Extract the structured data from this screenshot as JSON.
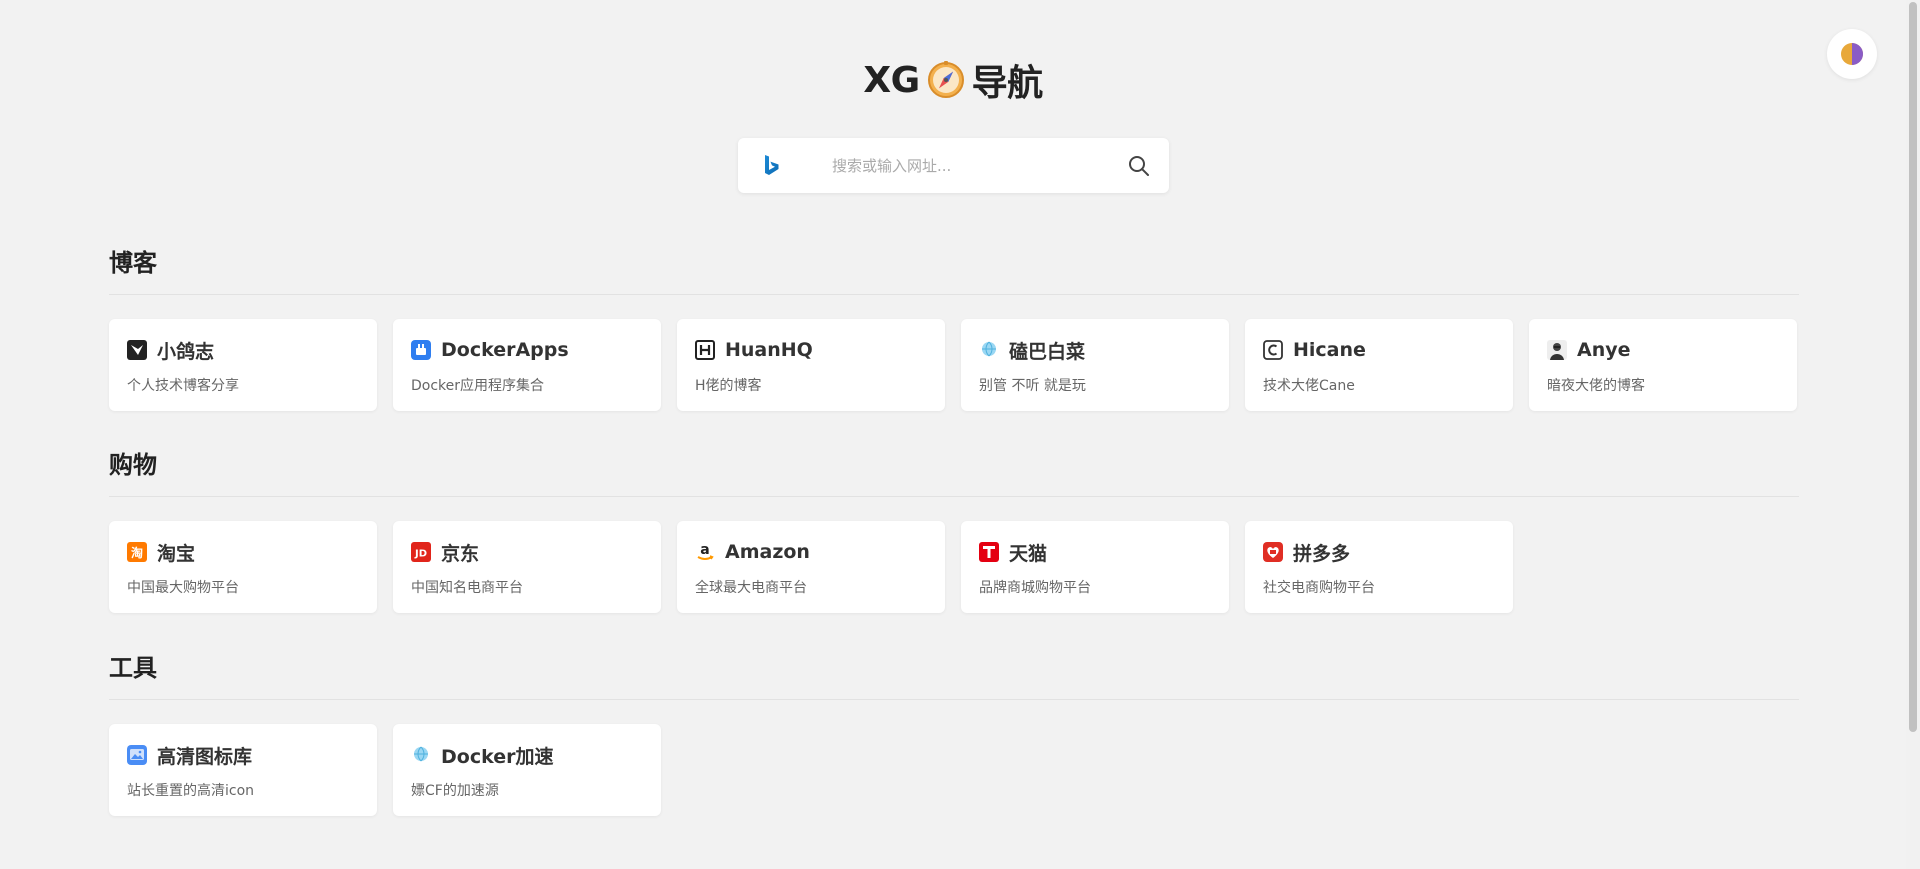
{
  "header": {
    "title_prefix": "XG",
    "title_suffix": "导航",
    "logo_icon": "compass-icon"
  },
  "search": {
    "engine_icon": "bing-icon",
    "placeholder": "搜索或输入网址...",
    "value": ""
  },
  "theme_toggle": {
    "icon": "theme-toggle-icon"
  },
  "sections": [
    {
      "title": "博客",
      "cards": [
        {
          "title": "小鸽志",
          "desc": "个人技术博客分享",
          "icon": "xiaogezhi-icon"
        },
        {
          "title": "DockerApps",
          "desc": "Docker应用程序集合",
          "icon": "dockerapps-icon"
        },
        {
          "title": "HuanHQ",
          "desc": "H佬的博客",
          "icon": "huanhq-icon"
        },
        {
          "title": "磕巴白菜",
          "desc": "别管 不听 就是玩",
          "icon": "globe-icon"
        },
        {
          "title": "Hicane",
          "desc": "技术大佬Cane",
          "icon": "hicane-icon"
        },
        {
          "title": "Anye",
          "desc": "暗夜大佬的博客",
          "icon": "anye-avatar-icon"
        }
      ]
    },
    {
      "title": "购物",
      "cards": [
        {
          "title": "淘宝",
          "desc": "中国最大购物平台",
          "icon": "taobao-icon"
        },
        {
          "title": "京东",
          "desc": "中国知名电商平台",
          "icon": "jd-icon"
        },
        {
          "title": "Amazon",
          "desc": "全球最大电商平台",
          "icon": "amazon-icon"
        },
        {
          "title": "天猫",
          "desc": "品牌商城购物平台",
          "icon": "tmall-icon"
        },
        {
          "title": "拼多多",
          "desc": "社交电商购物平台",
          "icon": "pinduoduo-icon"
        }
      ]
    },
    {
      "title": "工具",
      "cards": [
        {
          "title": "高清图标库",
          "desc": "站长重置的高清icon",
          "icon": "image-gallery-icon"
        },
        {
          "title": "Docker加速",
          "desc": "嫖CF的加速源",
          "icon": "globe-icon"
        }
      ]
    }
  ]
}
